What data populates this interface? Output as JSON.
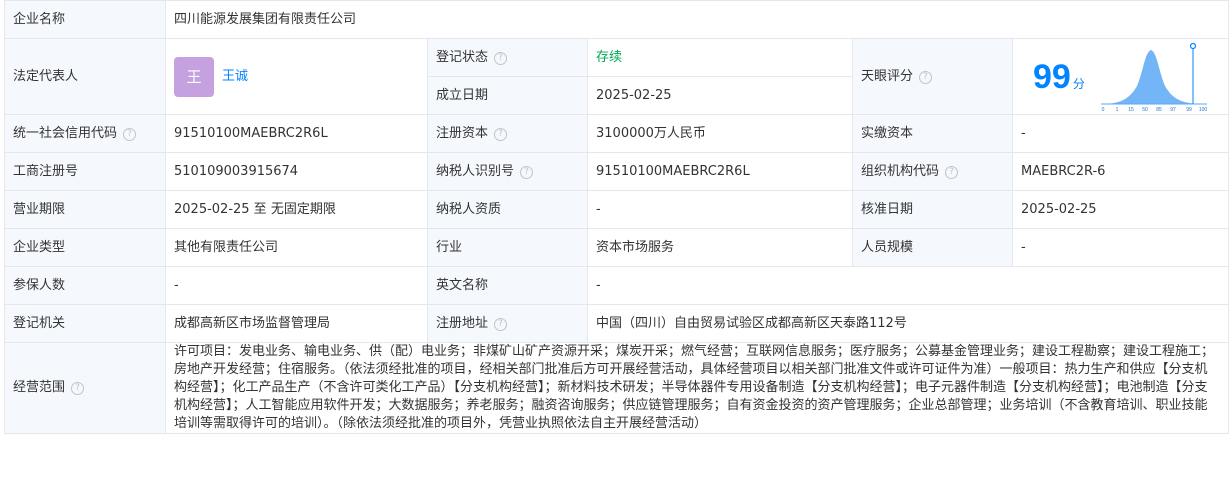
{
  "company_name_label": "企业名称",
  "company_name": "四川能源发展集团有限责任公司",
  "legal_rep": {
    "label": "法定代表人",
    "avatar_char": "王",
    "name": "王诚"
  },
  "reg_status": {
    "label": "登记状态",
    "value": "存续"
  },
  "established": {
    "label": "成立日期",
    "value": "2025-02-25"
  },
  "tianyan": {
    "label": "天眼评分",
    "score": "99",
    "unit": "分",
    "ticks": [
      "0",
      "1",
      "15",
      "50",
      "85",
      "97",
      "99",
      "100"
    ]
  },
  "credit_code": {
    "label": "统一社会信用代码",
    "value": "91510100MAEBRC2R6L"
  },
  "reg_capital": {
    "label": "注册资本",
    "value": "3100000万人民币"
  },
  "paid_capital": {
    "label": "实缴资本",
    "value": "-"
  },
  "biz_reg_no": {
    "label": "工商注册号",
    "value": "510109003915674"
  },
  "taxpayer_id": {
    "label": "纳税人识别号",
    "value": "91510100MAEBRC2R6L"
  },
  "org_code": {
    "label": "组织机构代码",
    "value": "MAEBRC2R-6"
  },
  "biz_term": {
    "label": "营业期限",
    "value": "2025-02-25 至 无固定期限"
  },
  "taxpayer_qual": {
    "label": "纳税人资质",
    "value": "-"
  },
  "approval_date": {
    "label": "核准日期",
    "value": "2025-02-25"
  },
  "company_type": {
    "label": "企业类型",
    "value": "其他有限责任公司"
  },
  "industry": {
    "label": "行业",
    "value": "资本市场服务"
  },
  "staff_size": {
    "label": "人员规模",
    "value": "-"
  },
  "insured": {
    "label": "参保人数",
    "value": "-"
  },
  "english_name": {
    "label": "英文名称",
    "value": "-"
  },
  "reg_authority": {
    "label": "登记机关",
    "value": "成都高新区市场监督管理局"
  },
  "reg_address": {
    "label": "注册地址",
    "value": "中国（四川）自由贸易试验区成都高新区天泰路112号"
  },
  "scope": {
    "label": "经营范围",
    "value": "许可项目：发电业务、输电业务、供（配）电业务；非煤矿山矿产资源开采；煤炭开采；燃气经营；互联网信息服务；医疗服务；公募基金管理业务；建设工程勘察；建设工程施工；房地产开发经营；住宿服务。（依法须经批准的项目，经相关部门批准后方可开展经营活动，具体经营项目以相关部门批准文件或许可证件为准）一般项目：热力生产和供应【分支机构经营】；化工产品生产（不含许可类化工产品）【分支机构经营】；新材料技术研发；半导体器件专用设备制造【分支机构经营】；电子元器件制造【分支机构经营】；电池制造【分支机构经营】；人工智能应用软件开发；大数据服务；养老服务；融资咨询服务；供应链管理服务；自有资金投资的资产管理服务；企业总部管理；业务培训（不含教育培训、职业技能培训等需取得许可的培训）。（除依法须经批准的项目外，凭营业执照依法自主开展经营活动）"
  },
  "colors": {
    "label_bg": "#f5f8fd",
    "border": "#e4e7ed",
    "accent": "#0084ff",
    "status_green": "#00a854",
    "avatar_bg": "#c6a1e0"
  }
}
